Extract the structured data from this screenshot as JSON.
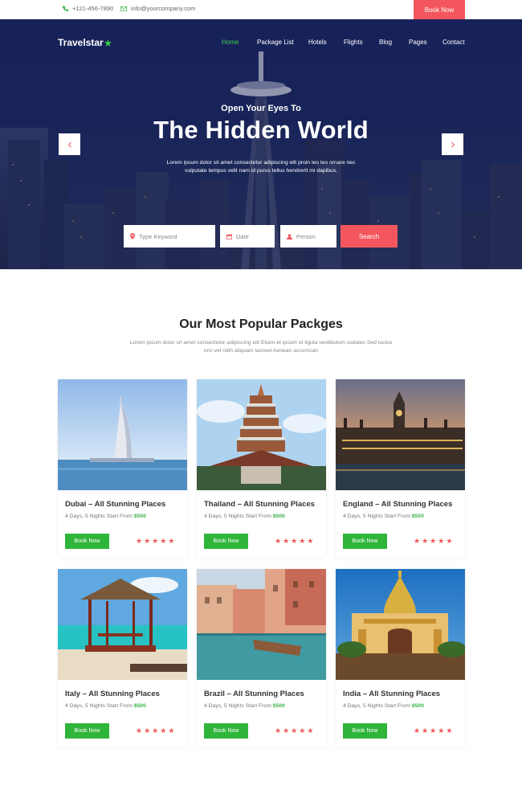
{
  "topbar": {
    "phone": "+121-456-7890",
    "email": "info@yourcompany.com",
    "book_label": "Book Now"
  },
  "brand": {
    "name": "Travelstar"
  },
  "nav": {
    "items": [
      "Home",
      "Package List",
      "Hotels",
      "Flights",
      "Blog",
      "Pages",
      "Contact"
    ],
    "active": "Home"
  },
  "hero": {
    "subtitle": "Open Your Eyes To",
    "title": "The Hidden World",
    "description": "Lorem ipsum dolor sit amet consectetur adipiscing elit proin leo leo ornare nec vulputate tempus velit nam id purus tellus hendrerit mi dapibus.",
    "search": {
      "keyword_placeholder": "Type Keyword",
      "date_placeholder": "Date",
      "person_placeholder": "Person",
      "button_label": "Search"
    }
  },
  "popular": {
    "title": "Our Most Popular Packges",
    "description": "Lorem ipsum dolor sit amet consectetur adipiscing elit Etiam et ipsum et ligula vestibulum sodales Sed luctus orci vel nibh aliquam laoreet Aenean accumsan",
    "packages": [
      {
        "title": "Dubai – All Stunning Places",
        "duration": "4 Days, 5 Nights Start From",
        "price": "$500",
        "button": "Book Now",
        "rating": 5
      },
      {
        "title": "Thailand – All Stunning Places",
        "duration": "4 Days, 5 Nights Start From",
        "price": "$500",
        "button": "Book Now",
        "rating": 5
      },
      {
        "title": "England – All Stunning Places",
        "duration": "4 Days, 5 Nights Start From",
        "price": "$500",
        "button": "Book Now",
        "rating": 5
      },
      {
        "title": "Italy – All Stunning Places",
        "duration": "4 Days, 5 Nights Start From",
        "price": "$500",
        "button": "Book Now",
        "rating": 5
      },
      {
        "title": "Brazil – All Stunning Places",
        "duration": "4 Days, 5 Nights Start From",
        "price": "$500",
        "button": "Book Now",
        "rating": 5
      },
      {
        "title": "India – All Stunning Places",
        "duration": "4 Days, 5 Nights Start From",
        "price": "$500",
        "button": "Book Now",
        "rating": 5
      }
    ]
  },
  "colors": {
    "accent_red": "#f3575d",
    "accent_green": "#2fb53a",
    "hero_navy": "#1b2660"
  }
}
